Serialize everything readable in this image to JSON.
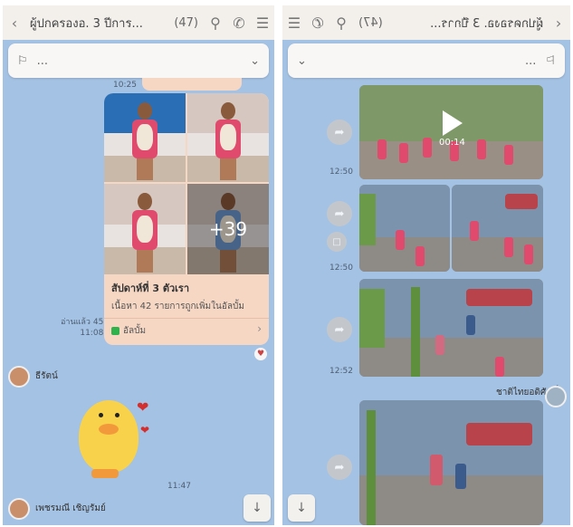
{
  "left": {
    "header": {
      "back_icon": "chevron-left-icon",
      "title": "ผู้ปกครองอ. 3 ปีการ...",
      "count": "(47)",
      "search_icon": "search-icon",
      "call_icon": "phone-icon",
      "menu_icon": "menu-icon"
    },
    "note_bar": {
      "text": "...",
      "icon": "megaphone-icon"
    },
    "top_time": "10:25",
    "album": {
      "more_label": "+39",
      "title": "สัปดาห์ที่ 3 ตัวเรา",
      "desc": "เนื้อหา 42 รายการถูกเพิ่มในอัลบั้ม",
      "link": "อัลบั้ม"
    },
    "read_meta": {
      "read": "อ่านแล้ว 45",
      "time": "11:08"
    },
    "sender1": "ธีรัตน์",
    "sticker_time": "11:47",
    "sender2": "เพชรมณี เชิญรัมย์"
  },
  "right": {
    "header": {
      "back_icon": "chevron-left-icon",
      "title": "ผู้ปกครองอ. 3 ปีการ...",
      "count": "(47)"
    },
    "note_bar": {
      "text": "..."
    },
    "video": {
      "duration": "00:14",
      "time": "12:50"
    },
    "photos1_time": "12:50",
    "photos2_time": "12:52",
    "sender": "ชาติไทยอดิศักดิ์"
  }
}
